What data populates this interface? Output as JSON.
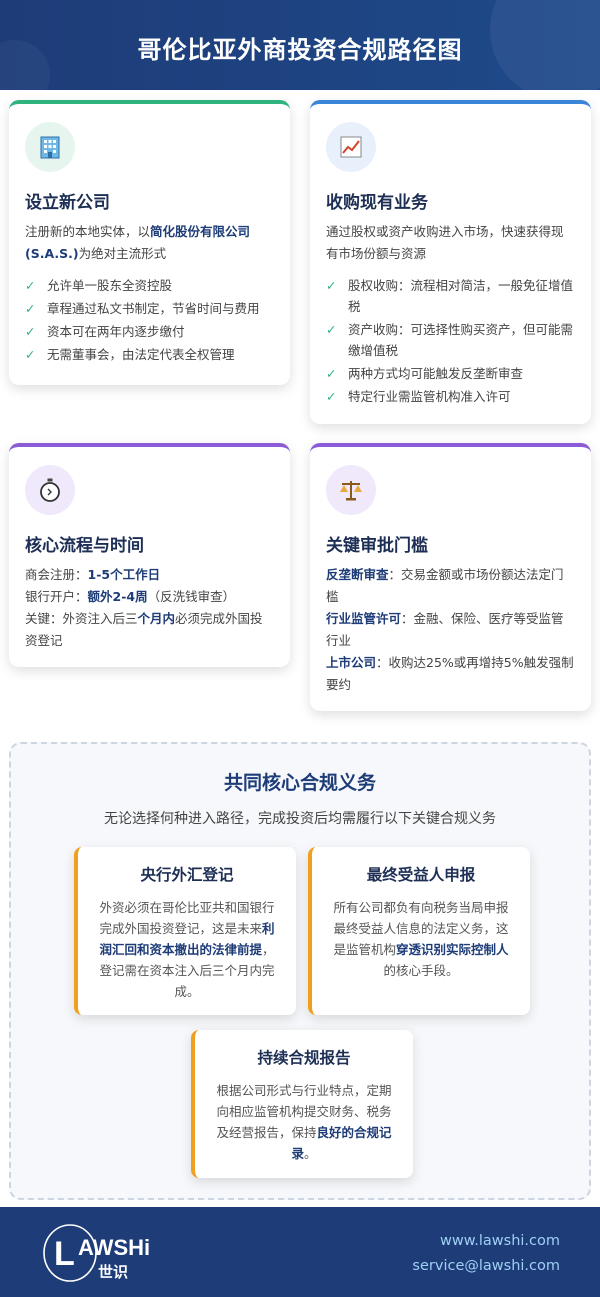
{
  "header": {
    "title": "哥伦比亚外商投资合规路径图"
  },
  "cards": {
    "new_company": {
      "title": "设立新公司",
      "desc_pre": "注册新的本地实体，以",
      "desc_hl": "简化股份有限公司(S.A.S.)",
      "desc_post": "为绝对主流形式",
      "items": [
        "允许单一股东全资控股",
        "章程通过私文书制定，节省时间与费用",
        "资本可在两年内逐步缴付",
        "无需董事会，由法定代表全权管理"
      ]
    },
    "acquisition": {
      "title": "收购现有业务",
      "desc": "通过股权或资产收购进入市场，快速获得现有市场份额与资源",
      "items": [
        "股权收购：流程相对简洁，一般免征增值税",
        "资产收购：可选择性购买资产，但可能需缴增值税",
        "两种方式均可能触发反垄断审查",
        "特定行业需监管机构准入许可"
      ]
    },
    "process": {
      "title": "核心流程与时间",
      "l1_label": "商会注册：",
      "l1_value": "1-5个工作日",
      "l2_label": "银行开户：",
      "l2_value": "额外2-4周",
      "l2_note": "（反洗钱审查）",
      "l3_pre": "关键：外资注入后三",
      "l3_hl": "个月内",
      "l3_post": "必须完成外国投资登记"
    },
    "approval": {
      "title": "关键审批门槛",
      "r1_label": "反垄断审查",
      "r1_text": "：交易金额或市场份额达法定门槛",
      "r2_label": "行业监管许可",
      "r2_text": "：金融、保险、医疗等受监管行业",
      "r3_label": "上市公司",
      "r3_text": "：收购达25%或再增持5%触发强制要约"
    }
  },
  "common": {
    "title": "共同核心合规义务",
    "subtitle": "无论选择何种进入路径，完成投资后均需履行以下关键合规义务",
    "fx": {
      "title": "央行外汇登记",
      "t1": "外资必须在哥伦比亚共和国银行完成外国投资登记，这是未来",
      "hl": "利润汇回和资本撤出的法律前提",
      "t2": "，登记需在资本注入后三个月内完成。"
    },
    "ubo": {
      "title": "最终受益人申报",
      "t1": "所有公司都负有向税务当局申报最终受益人信息的法定义务，这是监管机构",
      "hl": "穿透识别实际控制人",
      "t2": "的核心手段。"
    },
    "report": {
      "title": "持续合规报告",
      "t1": "根据公司形式与行业特点，定期向相应监管机构提交财务、税务及经营报告，保持",
      "hl": "良好的合规记录",
      "t2": "。"
    }
  },
  "footer": {
    "logo_text": "LAWSHi",
    "logo_cn": "世识",
    "website": "www.lawshi.com",
    "email": "service@lawshi.com"
  },
  "colors": {
    "brand": "#1e3c78",
    "green": "#2fb37f",
    "blue": "#3a85d8",
    "purple": "#8b5cd6",
    "orange": "#f0a020"
  },
  "icons": [
    "building-icon",
    "chart-icon",
    "stopwatch-icon",
    "scales-icon"
  ]
}
